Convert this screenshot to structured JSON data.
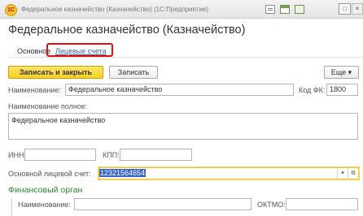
{
  "window": {
    "title": "Федеральное казначейство (Казначейство)  (1С:Предприятие)",
    "logo_text": "1С",
    "buttons": {
      "maximize": "□",
      "close": "×"
    }
  },
  "form": {
    "title": "Федеральное казначейство (Казначейство)",
    "tabs": [
      "Основное",
      "Лицевые счета"
    ]
  },
  "toolbar": {
    "save_close": "Записать и закрыть",
    "save": "Записать",
    "more": "Еще ▾"
  },
  "fields": {
    "name": {
      "label": "Наименование:",
      "value": "Федеральное казначейство"
    },
    "fk_code": {
      "label": "Код ФК:",
      "value": "1800"
    },
    "full_name": {
      "label": "Наименование полное:",
      "value": "Федеральное казначейство"
    },
    "inn": {
      "label": "ИНН:",
      "value": ""
    },
    "kpp": {
      "label": "КПП:",
      "value": ""
    },
    "main_account": {
      "label": "Основной лицевой счет:",
      "value": "12321564654",
      "dropdown": "▾",
      "open": "⧉"
    }
  },
  "financial_body": {
    "section_title": "Финансовый орган",
    "name_label": "Наименование:",
    "name_value": "",
    "oktmo_label": "ОКТМО:",
    "oktmo_value": ""
  },
  "colors": {
    "accent_yellow": "#f5cf21",
    "link_blue": "#3b63b8",
    "section_green": "#2b8a2b",
    "highlight_red": "#e01010",
    "selection_blue": "#3b66c4"
  }
}
